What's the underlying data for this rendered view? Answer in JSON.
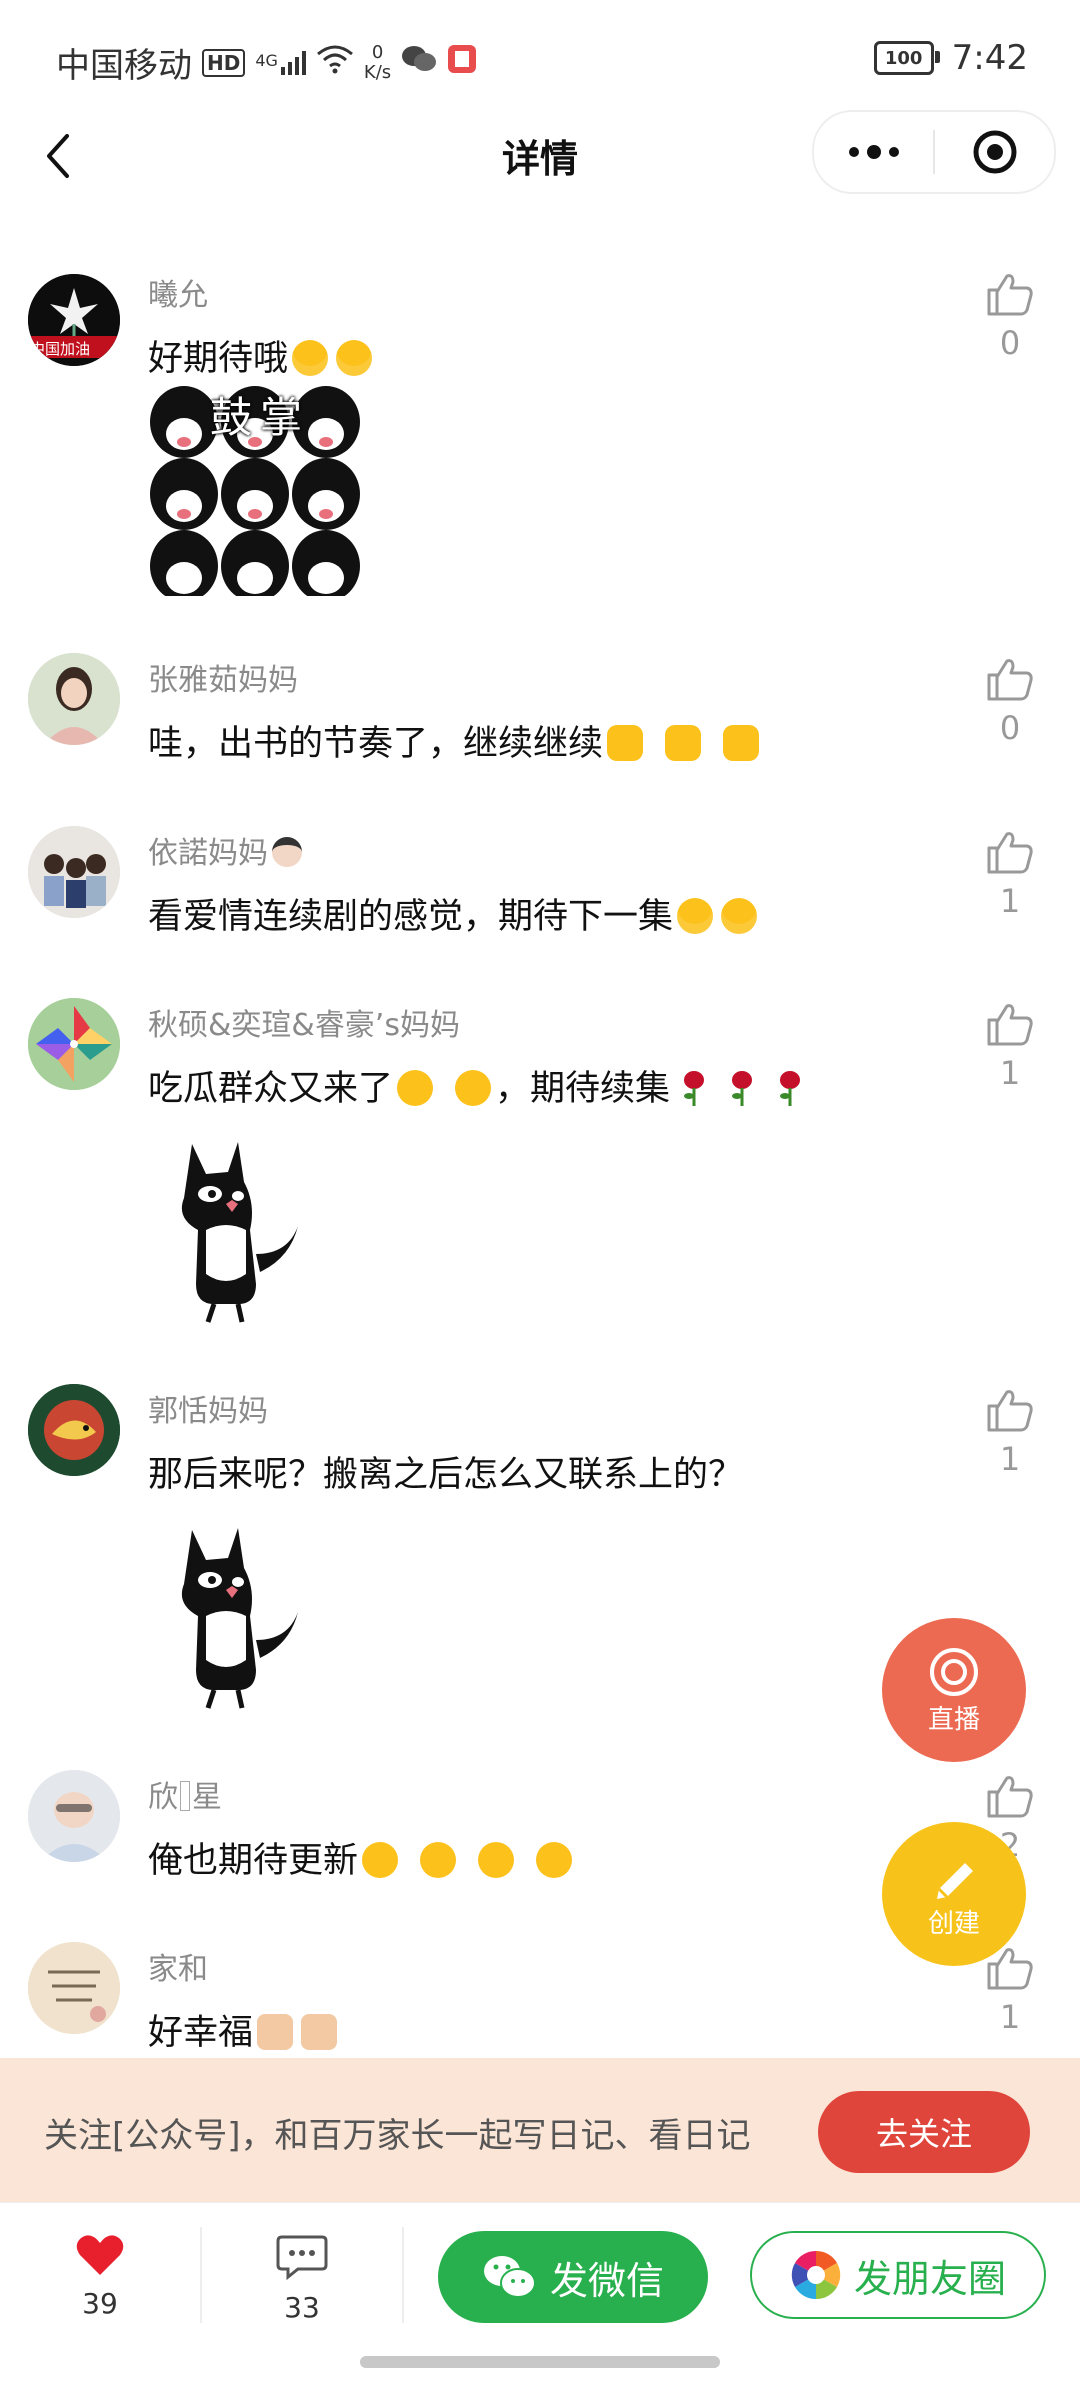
{
  "status_bar": {
    "carrier": "中国移动",
    "hd": "HD",
    "network": "4G",
    "speed_value": "0",
    "speed_unit": "K/s",
    "battery": "100",
    "time": "7:42"
  },
  "nav": {
    "title": "详情"
  },
  "comments": [
    {
      "name": "曦允",
      "text": "好期待哦",
      "likes": "0"
    },
    {
      "name": "张雅茹妈妈",
      "text": "哇，出书的节奏了，继续继续",
      "likes": "0"
    },
    {
      "name": "依諾妈妈",
      "text": "看爱情连续剧的感觉，期待下一集",
      "likes": "1"
    },
    {
      "name": "秋硕&奕瑄&睿豪’s妈妈",
      "text_a": "吃瓜群众又来了",
      "text_b": "，期待续集",
      "likes": "1"
    },
    {
      "name": "郭恬妈妈",
      "text": "那后来呢？搬离之后怎么又联系上的？",
      "likes": "1"
    },
    {
      "name": "欣&#x;星",
      "text": "俺也期待更新",
      "likes": "2"
    },
    {
      "name": "家和",
      "text": "好幸福",
      "likes": "1"
    }
  ],
  "sticker1_caption": "鼓掌",
  "avatar1_text": "中国加油",
  "floating": {
    "live": "直播",
    "create": "创建"
  },
  "banner": {
    "text": "关注[公众号]，和百万家长一起写日记、看日记",
    "button": "去关注"
  },
  "bottom": {
    "likes": "39",
    "comments": "33",
    "wechat": "发微信",
    "moments": "发朋友圈"
  },
  "colors": {
    "accent_red": "#e0453c",
    "green": "#29b04e",
    "yellow": "#f7c21a",
    "orange_red": "#ec6a52",
    "banner_bg": "#fbe5d6"
  }
}
